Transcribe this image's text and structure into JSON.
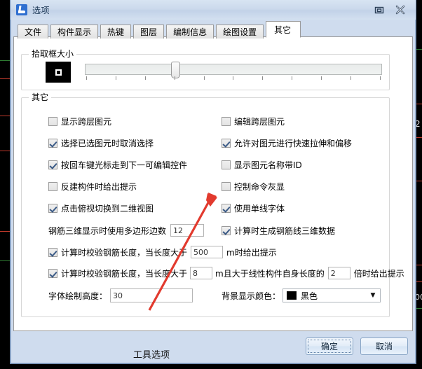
{
  "window": {
    "title": "选项",
    "icon": "app-icon",
    "buttons": {
      "restore": "restore-icon",
      "close": "close-icon"
    }
  },
  "tabs": [
    {
      "label": "文件",
      "active": false
    },
    {
      "label": "构件显示",
      "active": false
    },
    {
      "label": "热键",
      "active": false
    },
    {
      "label": "图层",
      "active": false
    },
    {
      "label": "编制信息",
      "active": false
    },
    {
      "label": "绘图设置",
      "active": false
    },
    {
      "label": "其它",
      "active": true
    }
  ],
  "groups": {
    "pick_box": {
      "title": "拾取框大小",
      "preview_color": "#000000",
      "slider": {
        "value_pct": 29,
        "tick_count": 11
      }
    },
    "other": {
      "title": "其它"
    }
  },
  "checkboxes": {
    "left": [
      {
        "label": "显示跨层图元",
        "checked": false
      },
      {
        "label": "选择已选图元时取消选择",
        "checked": true
      },
      {
        "label": "按回车键光标走到下一可编辑控件",
        "checked": true
      },
      {
        "label": "反建构件时给出提示",
        "checked": false
      },
      {
        "label": "点击俯视切换到二维视图",
        "checked": true
      }
    ],
    "right": [
      {
        "label": "编辑跨层图元",
        "checked": false
      },
      {
        "label": "允许对图元进行快速拉伸和偏移",
        "checked": true
      },
      {
        "label": "显示图元名称带ID",
        "checked": false
      },
      {
        "label": "控制命令灰显",
        "checked": false
      },
      {
        "label": "使用单线字体",
        "checked": true
      }
    ]
  },
  "rows": {
    "polygon_sides": {
      "label": "钢筋三维显示时使用多边形边数",
      "value": "12"
    },
    "gen_3d_rebar": {
      "label": "计算时生成钢筋线三维数据",
      "checked": true
    },
    "check_len_1": {
      "label_before": "计算时校验钢筋长度，当长度大于",
      "value": "500",
      "label_after": "m时给出提示",
      "checked": true
    },
    "check_len_2": {
      "label_before": "计算时校验钢筋长度，当长度大于",
      "value1": "8",
      "label_mid": "m且大于线性构件自身长度的",
      "value2": "2",
      "label_after": "倍时给出提示",
      "checked": true
    },
    "font_height": {
      "label": "字体绘制高度：",
      "value": "30"
    },
    "bg_color": {
      "label": "背景显示颜色：",
      "value": "黑色",
      "swatch": "#000000",
      "arrow": "chevron-down-icon"
    }
  },
  "annotation": {
    "text": "工具选项",
    "arrow_color": "#e23a2e"
  },
  "footer": {
    "ok": "确定",
    "cancel": "取消"
  }
}
